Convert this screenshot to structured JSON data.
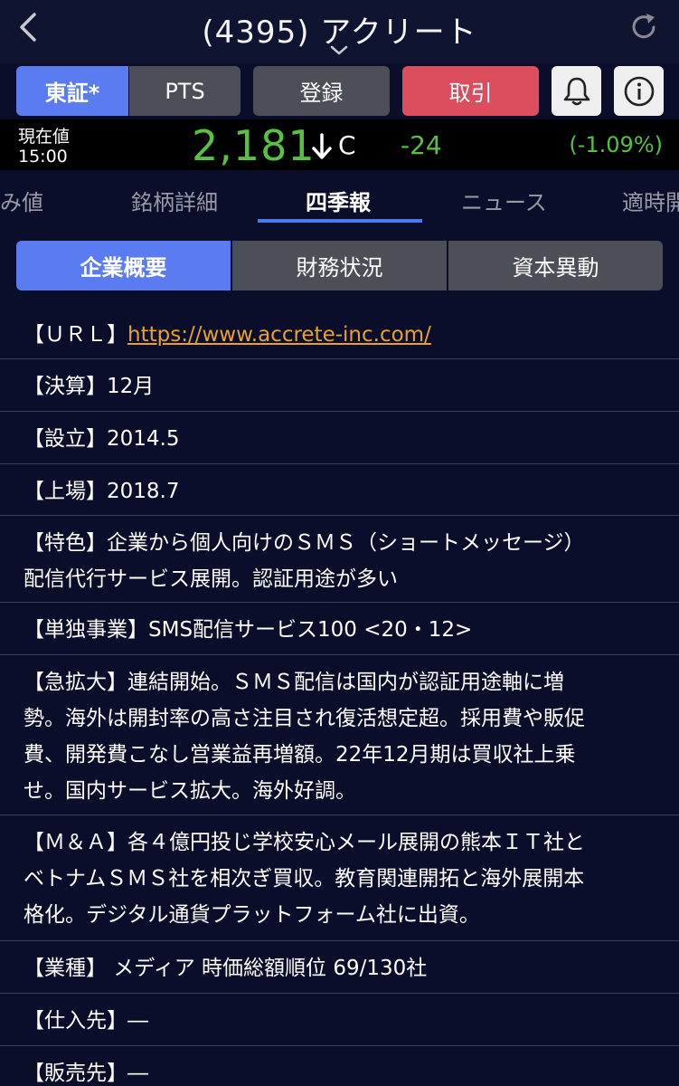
{
  "header": {
    "title": "(4395) アクリート"
  },
  "buttons": {
    "market_tosho": "東証*",
    "market_pts": "PTS",
    "register": "登録",
    "trade": "取引"
  },
  "price": {
    "label_current": "現在値",
    "time": "15:00",
    "value": "2,181",
    "c_mark": "C",
    "change": "-24",
    "change_pct": "(-1.09%)"
  },
  "tabs": [
    "み値",
    "銘柄詳細",
    "四季報",
    "ニュース",
    "適時開"
  ],
  "subtabs": [
    "企業概要",
    "財務状況",
    "資本異動"
  ],
  "rows": {
    "url_key": "【ＵＲＬ】",
    "url_value": "https://www.accrete-inc.com/",
    "settle": "【決算】12月",
    "founded": "【設立】2014.5",
    "listed": "【上場】2018.7",
    "feature_1": "【特色】企業から個人向けのＳＭＳ（ショートメッセージ）",
    "feature_2": "配信代行サービス展開。認証用途が多い",
    "business": "【単独事業】SMS配信サービス100 <20・12>",
    "exp_1": "【急拡大】連結開始。ＳＭＳ配信は国内が認証用途軸に増",
    "exp_2": "勢。海外は開封率の高さ注目され復活想定超。採用費や販促",
    "exp_3": "費、開発費こなし営業益再増額。22年12月期は買収社上乗",
    "exp_4": "せ。国内サービス拡大。海外好調。",
    "ma_1": "【Ｍ＆Ａ】各４億円投じ学校安心メール展開の熊本ＩＴ社と",
    "ma_2": "ベトナムＳＭＳ社を相次ぎ買収。教育関連開拓と海外展開本",
    "ma_3": "格化。デジタル通貨プラットフォーム社に出資。",
    "industry": "【業種】 メディア 時価総額順位 69/130社",
    "supplier": "【仕入先】―",
    "customer": "【販売先】―"
  },
  "colors": {
    "background": "#0b0e2a",
    "accent_blue": "#5b7cf0",
    "trade_red": "#dc4e5e",
    "price_green": "#58c142",
    "link_orange": "#e8a030"
  },
  "icons": [
    "back-chevron-icon",
    "chevron-down-icon",
    "refresh-icon",
    "bell-icon",
    "info-icon",
    "down-arrow-icon"
  ]
}
